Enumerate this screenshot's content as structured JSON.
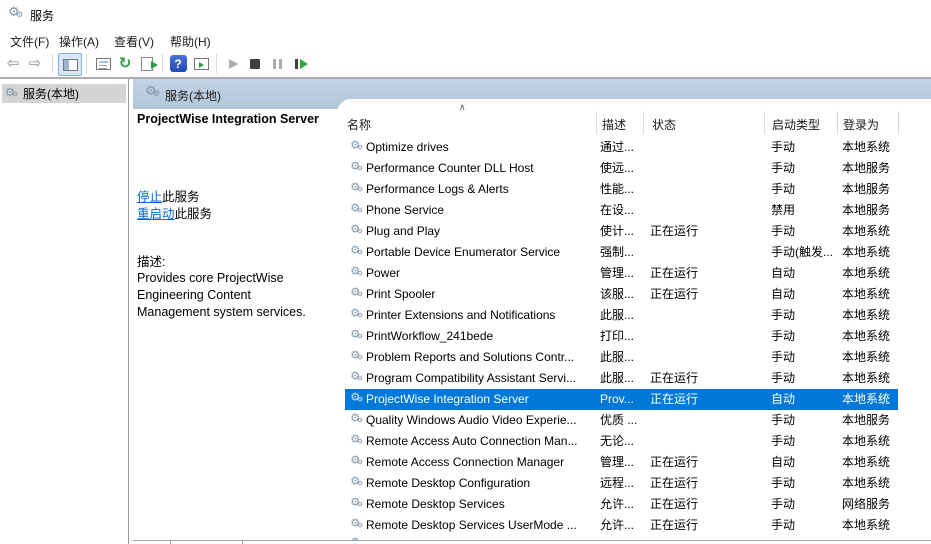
{
  "window": {
    "title": "服务"
  },
  "menu_bar": {
    "items": [
      {
        "label": "文件(F)"
      },
      {
        "label": "操作(A)"
      },
      {
        "label": "查看(V)"
      },
      {
        "label": "帮助(H)"
      }
    ]
  },
  "toolbar": {
    "icons": [
      "back",
      "forward",
      "show-hide-console-tree",
      "properties",
      "refresh",
      "export-list",
      "help",
      "show-hide-action-pane",
      "start-service",
      "stop-service",
      "pause-service",
      "restart-service"
    ]
  },
  "tree_pane": {
    "items": [
      {
        "label": "服务(本地)",
        "selected": true
      }
    ]
  },
  "taskpad": {
    "header": "服务(本地)",
    "service_title": "ProjectWise Integration Server",
    "stop_link": {
      "action": "停止",
      "suffix": "此服务"
    },
    "restart_link": {
      "action": "重启动",
      "suffix": "此服务"
    },
    "description_label": "描述:",
    "description_lines": [
      "Provides core ProjectWise",
      "Engineering Content",
      "Management system services."
    ]
  },
  "table": {
    "sort_indicator": "∧",
    "columns": [
      {
        "label": "名称"
      },
      {
        "label": "描述"
      },
      {
        "label": "状态"
      },
      {
        "label": "启动类型"
      },
      {
        "label": "登录为"
      }
    ],
    "rows": [
      {
        "name": "Optimize drives",
        "desc": "通过...",
        "status": "",
        "startup": "手动",
        "logon": "本地系统",
        "selected": false
      },
      {
        "name": "Performance Counter DLL Host",
        "desc": "使远...",
        "status": "",
        "startup": "手动",
        "logon": "本地服务",
        "selected": false
      },
      {
        "name": "Performance Logs & Alerts",
        "desc": "性能...",
        "status": "",
        "startup": "手动",
        "logon": "本地服务",
        "selected": false
      },
      {
        "name": "Phone Service",
        "desc": "在设...",
        "status": "",
        "startup": "禁用",
        "logon": "本地服务",
        "selected": false
      },
      {
        "name": "Plug and Play",
        "desc": "使计...",
        "status": "正在运行",
        "startup": "手动",
        "logon": "本地系统",
        "selected": false
      },
      {
        "name": "Portable Device Enumerator Service",
        "desc": "强制...",
        "status": "",
        "startup": "手动(触发...",
        "logon": "本地系统",
        "selected": false
      },
      {
        "name": "Power",
        "desc": "管理...",
        "status": "正在运行",
        "startup": "自动",
        "logon": "本地系统",
        "selected": false
      },
      {
        "name": "Print Spooler",
        "desc": "该服...",
        "status": "正在运行",
        "startup": "自动",
        "logon": "本地系统",
        "selected": false
      },
      {
        "name": "Printer Extensions and Notifications",
        "desc": "此服...",
        "status": "",
        "startup": "手动",
        "logon": "本地系统",
        "selected": false
      },
      {
        "name": "PrintWorkflow_241bede",
        "desc": "打印...",
        "status": "",
        "startup": "手动",
        "logon": "本地系统",
        "selected": false
      },
      {
        "name": "Problem Reports and Solutions Contr...",
        "desc": "此服...",
        "status": "",
        "startup": "手动",
        "logon": "本地系统",
        "selected": false
      },
      {
        "name": "Program Compatibility Assistant Servi...",
        "desc": "此服...",
        "status": "正在运行",
        "startup": "手动",
        "logon": "本地系统",
        "selected": false
      },
      {
        "name": "ProjectWise Integration Server",
        "desc": "Prov...",
        "status": "正在运行",
        "startup": "自动",
        "logon": "本地系统",
        "selected": true
      },
      {
        "name": "Quality Windows Audio Video Experie...",
        "desc": "优质 ...",
        "status": "",
        "startup": "手动",
        "logon": "本地服务",
        "selected": false
      },
      {
        "name": "Remote Access Auto Connection Man...",
        "desc": "无论...",
        "status": "",
        "startup": "手动",
        "logon": "本地系统",
        "selected": false
      },
      {
        "name": "Remote Access Connection Manager",
        "desc": "管理...",
        "status": "正在运行",
        "startup": "自动",
        "logon": "本地系统",
        "selected": false
      },
      {
        "name": "Remote Desktop Configuration",
        "desc": "远程...",
        "status": "正在运行",
        "startup": "手动",
        "logon": "本地系统",
        "selected": false
      },
      {
        "name": "Remote Desktop Services",
        "desc": "允许...",
        "status": "正在运行",
        "startup": "手动",
        "logon": "网络服务",
        "selected": false
      },
      {
        "name": "Remote Desktop Services UserMode ...",
        "desc": "允许...",
        "status": "正在运行",
        "startup": "手动",
        "logon": "本地系统",
        "selected": false
      }
    ]
  },
  "colors": {
    "selection": "#0078d7",
    "taskpad_header_blue": "#b9cbdf",
    "link_blue": "#0066cc"
  }
}
